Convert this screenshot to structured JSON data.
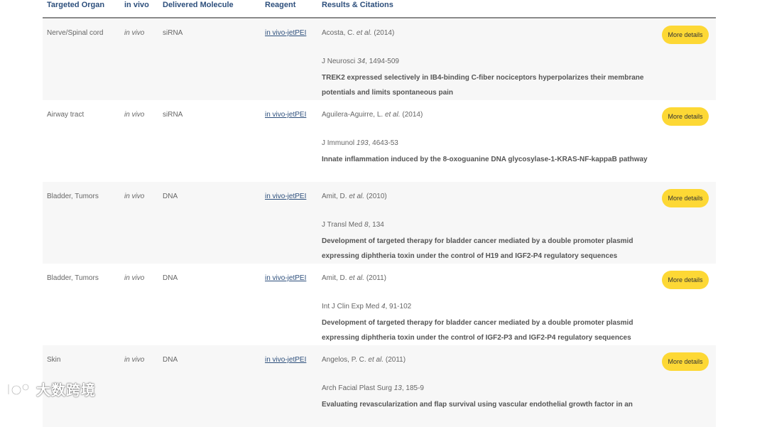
{
  "header": {
    "organ": "Targeted Organ",
    "in_vivo": "in vivo",
    "molecule": "Delivered Molecule",
    "reagent": "Reagent",
    "results": "Results & Citations"
  },
  "button_label": "More details",
  "rows": [
    {
      "organ": "Nerve/Spinal cord",
      "in_vivo": "in vivo",
      "molecule": "siRNA",
      "reagent": "in vivo-jetPEI",
      "author": "Acosta, C.",
      "et_al": "et al.",
      "year": "(2014)",
      "journal": "J Neurosci",
      "volume": "34",
      "pages": ", 1494-509",
      "title": "TREK2 expressed selectively in IB4-binding C-fiber nociceptors hyperpolarizes their membrane potentials and limits spontaneous pain"
    },
    {
      "organ": "Airway tract",
      "in_vivo": "in vivo",
      "molecule": "siRNA",
      "reagent": "in vivo-jetPEI",
      "author": "Aguilera-Aguirre, L.",
      "et_al": "et al.",
      "year": "(2014)",
      "journal": "J Immunol",
      "volume": "193",
      "pages": ", 4643-53",
      "title": "Innate inflammation induced by the 8-oxoguanine DNA glycosylase-1-KRAS-NF-kappaB pathway"
    },
    {
      "organ": "Bladder, Tumors",
      "in_vivo": "in vivo",
      "molecule": "DNA",
      "reagent": "in vivo-jetPEI",
      "author": "Amit, D.",
      "et_al": "et al.",
      "year": "(2010)",
      "journal": "J Transl Med",
      "volume": "8",
      "pages": ", 134",
      "title": "Development of targeted therapy for bladder cancer mediated by a double promoter plasmid expressing diphtheria toxin under the control of H19 and IGF2-P4 regulatory sequences"
    },
    {
      "organ": "Bladder, Tumors",
      "in_vivo": "in vivo",
      "molecule": "DNA",
      "reagent": "in vivo-jetPEI",
      "author": "Amit, D.",
      "et_al": "et al.",
      "year": "(2011)",
      "journal": "Int J Clin Exp Med",
      "volume": "4",
      "pages": ", 91-102",
      "title": "Development of targeted therapy for bladder cancer mediated by a double promoter plasmid expressing diphtheria toxin under the control of IGF2-P3 and IGF2-P4 regulatory sequences"
    },
    {
      "organ": "Skin",
      "in_vivo": "in vivo",
      "molecule": "DNA",
      "reagent": "in vivo-jetPEI",
      "author": "Angelos, P. C.",
      "et_al": "et al.",
      "year": "(2011)",
      "journal": "Arch Facial Plast Surg",
      "volume": "13",
      "pages": ", 185-9",
      "title": "Evaluating revascularization and flap survival using vascular endothelial growth factor in an"
    }
  ],
  "watermark": "大数跨境",
  "colors": {
    "header_text": "#2d4f7c",
    "button_bg": "#fdd835",
    "row_alt_bg": "#f7f7f7",
    "link": "#2d4f7c"
  }
}
